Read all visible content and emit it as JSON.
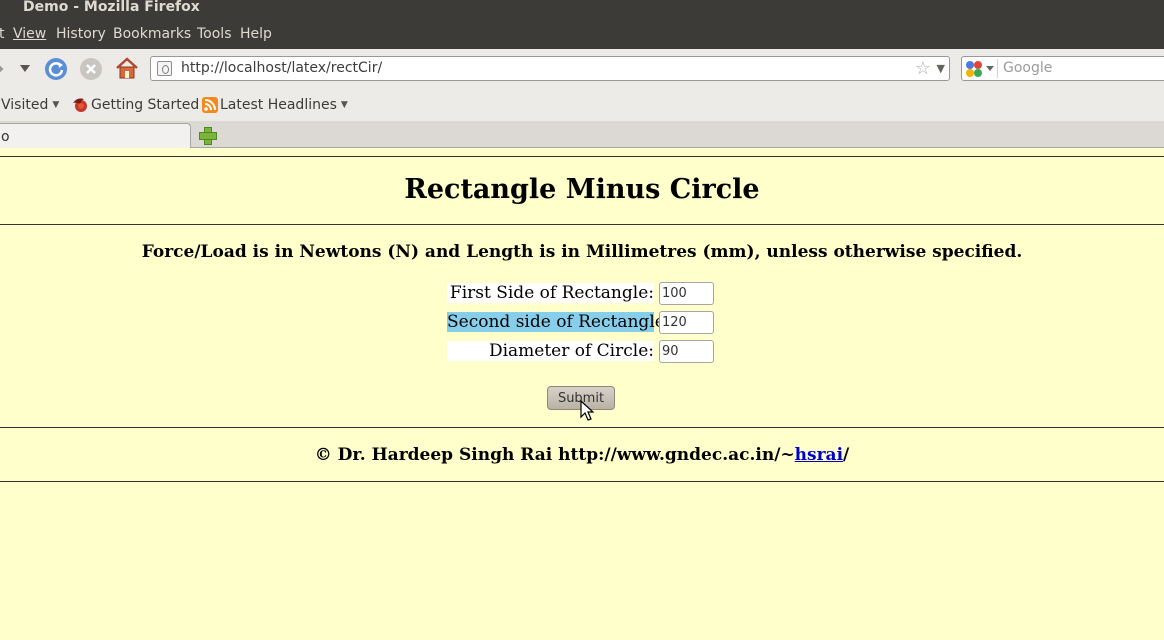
{
  "window": {
    "title": "Demo - Mozilla Firefox"
  },
  "menu": {
    "items": [
      "t",
      "View",
      "History",
      "Bookmarks",
      "Tools",
      "Help"
    ],
    "accesskeys": [
      "",
      "V",
      "s",
      "B",
      "T",
      "H"
    ]
  },
  "navbar": {
    "url": "http://localhost/latex/rectCir/",
    "search_placeholder": "Google"
  },
  "bookmarks": {
    "items": [
      "Visited",
      "Getting Started",
      "Latest Headlines"
    ]
  },
  "tab": {
    "label": "o"
  },
  "page": {
    "title": "Rectangle Minus Circle",
    "units_note": "Force/Load is in Newtons (N) and Length is in Millimetres (mm), unless otherwise specified.",
    "fields": [
      {
        "label": "First Side of Rectangle:",
        "value": "100"
      },
      {
        "label": "Second side of Rectangle:",
        "value": "120"
      },
      {
        "label": "Diameter of Circle:",
        "value": "90"
      }
    ],
    "submit_label": "Submit",
    "footer_text": "© Dr. Hardeep Singh Rai http://www.gndec.ac.in/~",
    "footer_link": "hsrai",
    "footer_suffix": "/"
  },
  "colors": {
    "page_background": "#ffffcc",
    "selection_highlight": "#87ceeb",
    "link": "#0000cc",
    "chrome_dark": "#3c3b37"
  }
}
